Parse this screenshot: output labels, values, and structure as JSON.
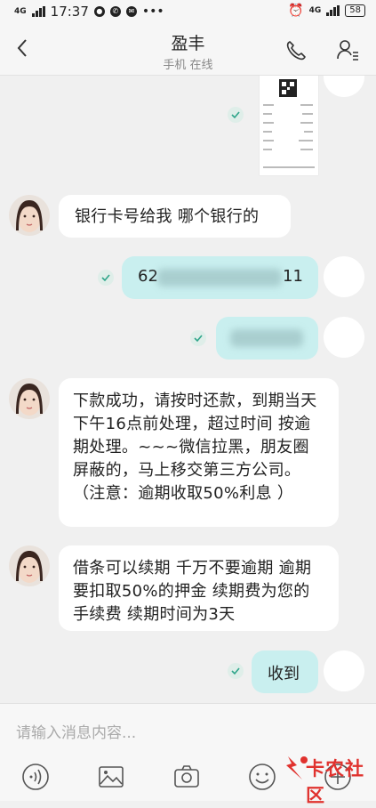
{
  "status_bar": {
    "time": "17:37",
    "network": "4G",
    "network_right": "4G",
    "battery": "58"
  },
  "header": {
    "title": "盈丰",
    "subtitle": "手机 在线"
  },
  "messages": {
    "m1": "银行卡号给我 哪个银行的",
    "m2_prefix": "62",
    "m2_suffix": "11",
    "m4": "下款成功，请按时还款，到期当天下午16点前处理，超过时间 按逾期处理。~~~微信拉黑，朋友圈屏蔽的，马上移交第三方公司。（注意：逾期收取50%利息 ）",
    "m5": "借条可以续期 千万不要逾期 逾期要扣取50%的押金 续期费为您的手续费 续期时间为3天",
    "m6": "收到"
  },
  "input": {
    "placeholder": "请输入消息内容..."
  },
  "watermark": {
    "text": "卡农社区"
  }
}
